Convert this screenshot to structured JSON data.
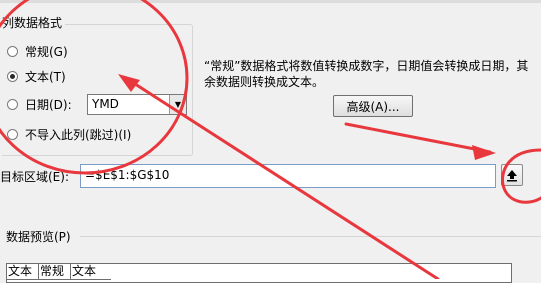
{
  "group": {
    "title": "列数据格式"
  },
  "options": [
    {
      "label": "常规(G)",
      "selected": false
    },
    {
      "label": "文本(T)",
      "selected": true
    },
    {
      "label": "日期(D):",
      "selected": false
    },
    {
      "label": "不导入此列(跳过)(I)",
      "selected": false
    }
  ],
  "date_format": {
    "value": "YMD",
    "icon": "chevron-down-icon"
  },
  "note": "“常规”数据格式将数值转换成数字，日期值会转换成日期，其余数据则转换成文本。",
  "advanced_button": {
    "label": "高级(A)..."
  },
  "destination": {
    "label": "目标区域(E):",
    "value": "=$E$1:$G$10"
  },
  "collapse_button": {
    "icon": "collapse-dialog-icon"
  },
  "preview": {
    "label": "数据预览(P)",
    "headers": [
      "文本",
      "常规",
      "文本"
    ]
  },
  "annotation_color": "#e8383d"
}
